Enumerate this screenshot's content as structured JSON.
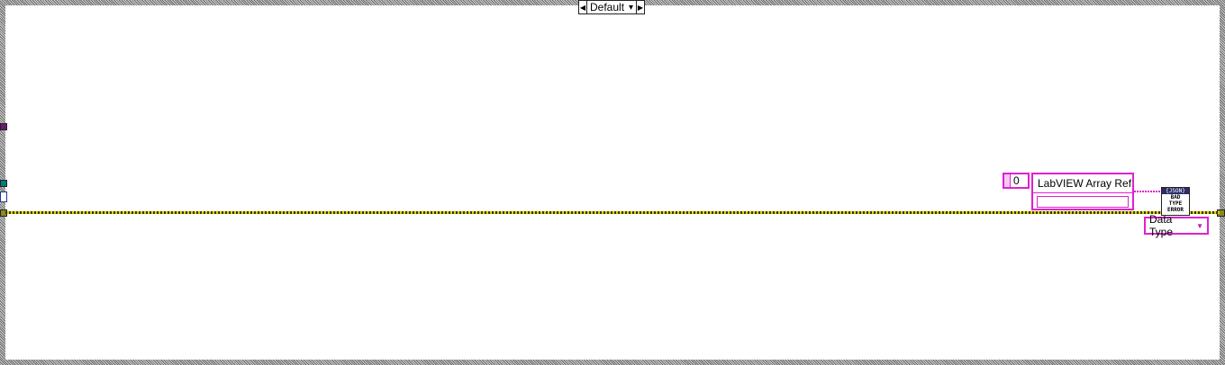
{
  "case_selector": {
    "label": "Default",
    "left_arrow": "◀",
    "right_arrow": "▶",
    "dropdown": "▾"
  },
  "constants": {
    "numeric_value": "0",
    "cluster_label": "LabVIEW Array Ref",
    "enum_label": "Data Type"
  },
  "subvi": {
    "header": "{JSON}",
    "line1": "BAD",
    "line2": "TYPE",
    "line3": "ERROR"
  },
  "colors": {
    "pink": "#e020d0",
    "yellow_wire": "#d8d000",
    "tunnel_teal": "#007a80",
    "tunnel_purple": "#6a1a70"
  },
  "icons": [
    "left-arrow-icon",
    "right-arrow-icon",
    "dropdown-caret-icon"
  ]
}
